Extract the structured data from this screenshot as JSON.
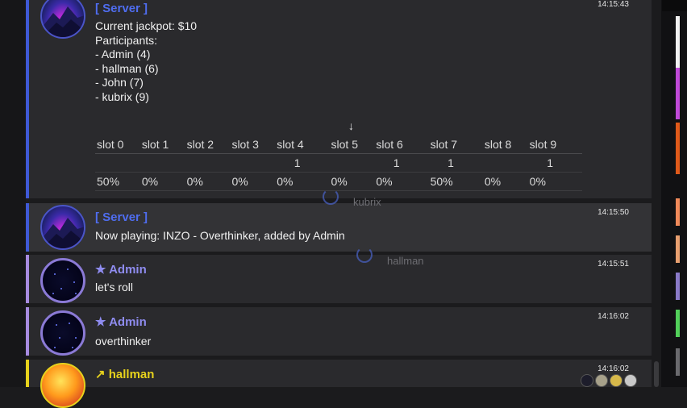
{
  "messages": {
    "jackpot": {
      "author": "[ Server ]",
      "time": "14:15:43",
      "lines": [
        "Current jackpot: $10",
        "Participants:",
        "- Admin (4)",
        "- hallman (6)",
        "- John (7)",
        "- kubrix (9)"
      ],
      "arrow": "↓",
      "slots": {
        "headers": [
          "slot 0",
          "slot 1",
          "slot 2",
          "slot 3",
          "slot 4",
          "slot 5",
          "slot 6",
          "slot 7",
          "slot 8",
          "slot 9"
        ],
        "counts": [
          "",
          "",
          "",
          "",
          "1",
          "",
          "1",
          "1",
          "",
          "1"
        ],
        "percents": [
          "50%",
          "0%",
          "0%",
          "0%",
          "0%",
          "0%",
          "0%",
          "50%",
          "0%",
          "0%"
        ]
      }
    },
    "now_playing": {
      "author": "[ Server ]",
      "time": "14:15:50",
      "text": "Now playing: INZO - Overthinker, added by Admin"
    },
    "admin1": {
      "author": "Admin",
      "badge": "★",
      "time": "14:15:51",
      "text": "let's roll"
    },
    "admin2": {
      "author": "Admin",
      "badge": "★",
      "time": "14:16:02",
      "text": "overthinker"
    },
    "hallman": {
      "author": "hallman",
      "badge": "↗",
      "time": "14:16:02"
    }
  },
  "overlays": {
    "typing_user_1": "kubrix",
    "typing_user_2": "hallman"
  },
  "icons": {
    "server_avatar": "mountain-avatar-icon",
    "admin_avatar": "space-avatar-icon",
    "hallman_avatar": "sun-avatar-icon",
    "loading": "spinner-icon"
  },
  "colors": {
    "server_accent": "#4f6df0",
    "admin_accent": "#8f8cf0",
    "hallman_accent": "#e7d21c"
  }
}
